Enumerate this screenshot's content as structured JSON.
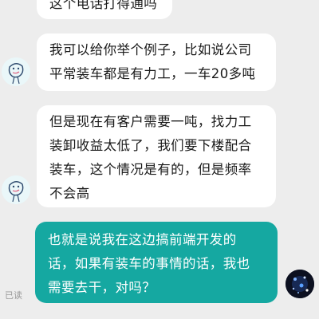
{
  "messages": [
    {
      "side": "in",
      "lines": [
        "这个电话打得通吗"
      ]
    },
    {
      "side": "in",
      "lines": [
        "我可以给你举个例子，比如说公司",
        "平常装车都是有力工，一车20多吨"
      ]
    },
    {
      "side": "in",
      "lines": [
        "但是现在有客户需要一吨，找力工",
        "装卸收益太低了，我们要下楼配合",
        "装车，这个情况是有的，但是频率",
        "不会高"
      ]
    },
    {
      "side": "out",
      "lines": [
        "也就是说我在这边搞前端开发的",
        "话，如果有装车的事情的话，我也",
        "需要去干，对吗？"
      ],
      "status": "已读"
    }
  ],
  "colors": {
    "background": "#ededed",
    "incoming_bubble": "#ffffff",
    "outgoing_bubble": "#15a8a1"
  },
  "icons": {
    "contact_avatar": "cartoon-character-avatar-icon",
    "user_avatar": "starry-night-avatar-icon"
  }
}
